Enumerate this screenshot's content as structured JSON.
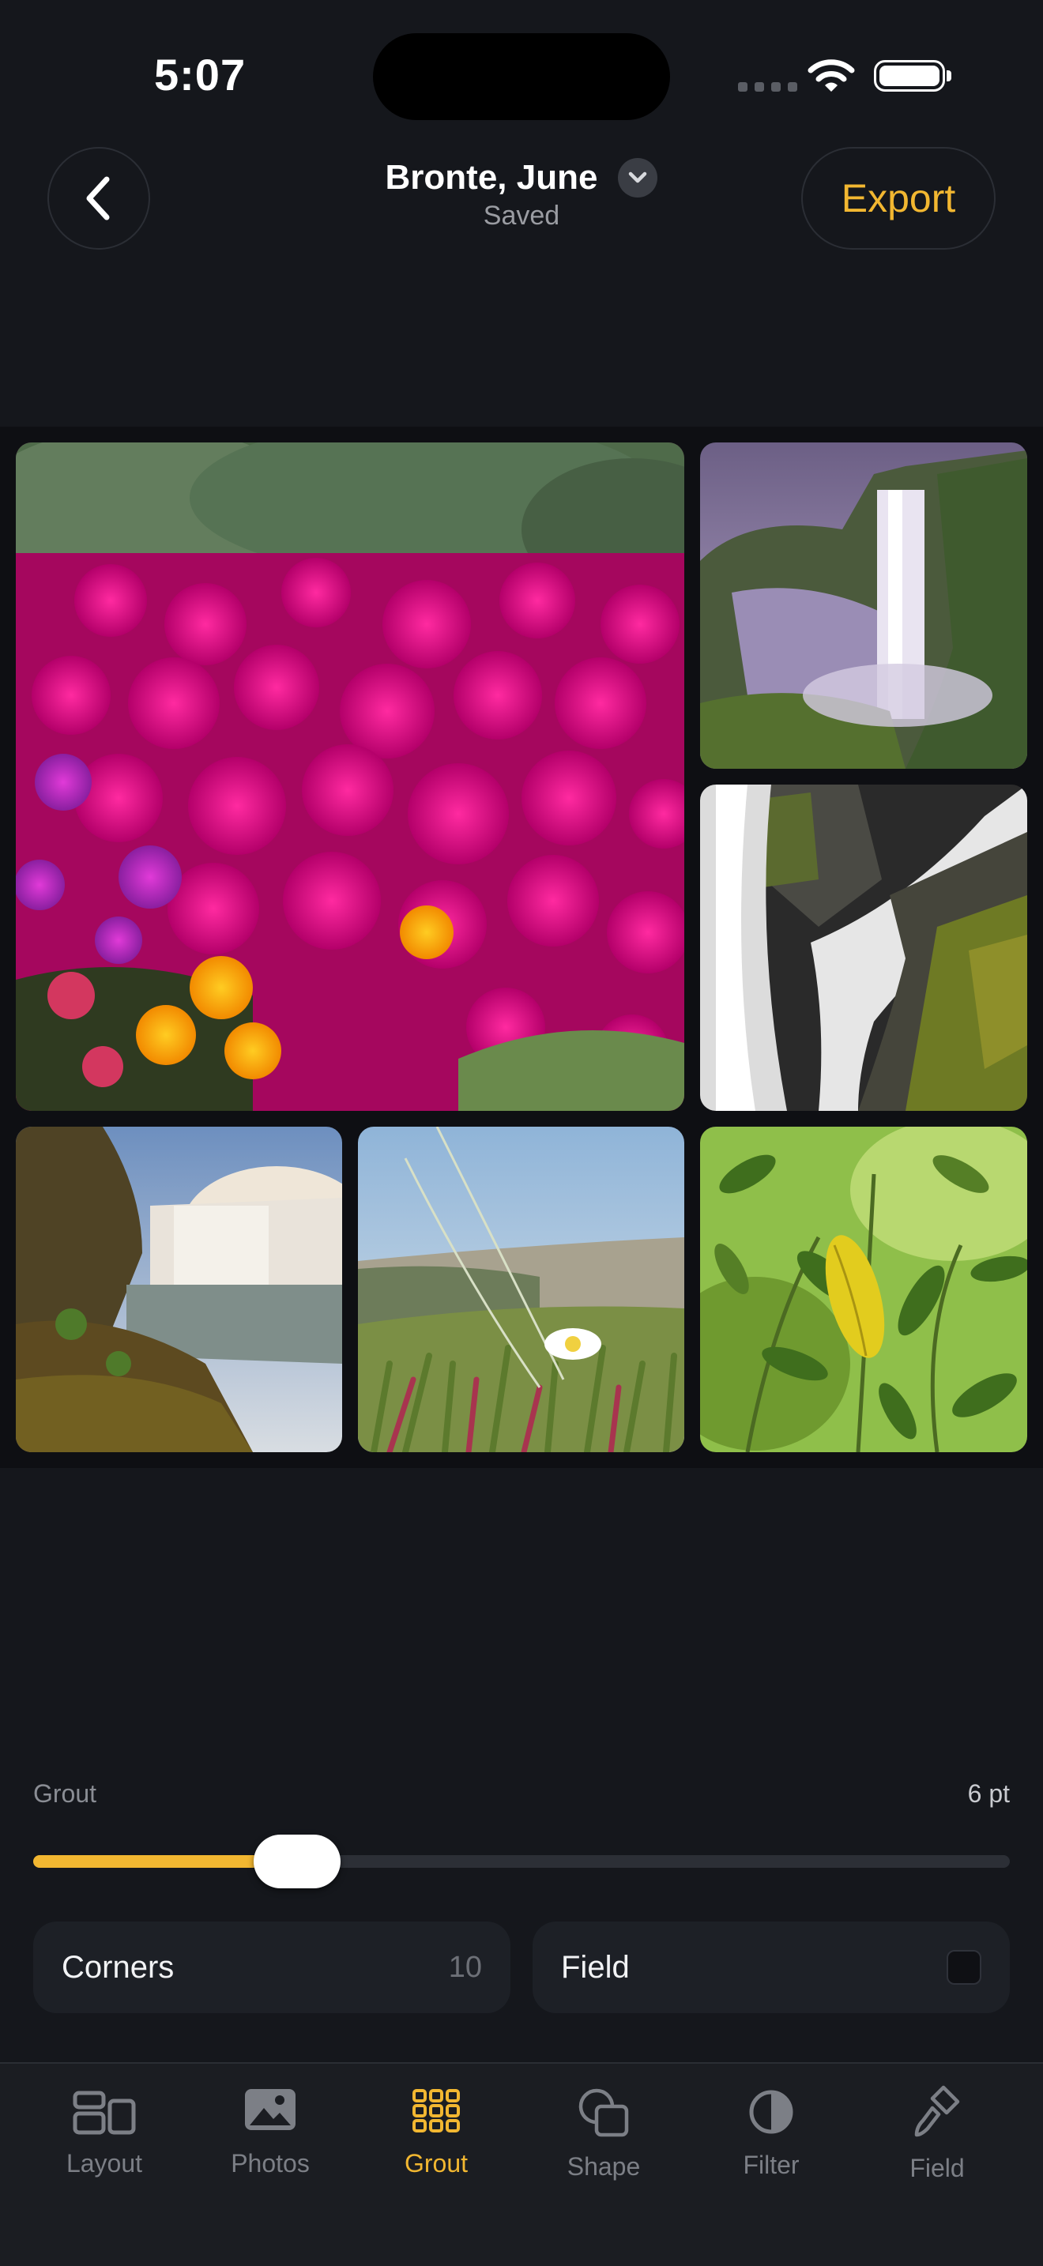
{
  "status": {
    "time": "5:07"
  },
  "header": {
    "title": "Bronte, June",
    "subtitle": "Saved",
    "export_label": "Export"
  },
  "collage": {
    "photos": [
      {
        "subject": "pink-ice-plant-flowers"
      },
      {
        "subject": "waterfall-misty-cliff"
      },
      {
        "subject": "waterfall-mossy-rock"
      },
      {
        "subject": "waterfall-coastal-rocks"
      },
      {
        "subject": "grass-white-flower"
      },
      {
        "subject": "green-leaves-yellow-leaf"
      }
    ]
  },
  "grout": {
    "label": "Grout",
    "value_text": "6 pt",
    "slider_fraction": 0.27
  },
  "cards": {
    "corners": {
      "label": "Corners",
      "value": "10"
    },
    "field": {
      "label": "Field",
      "checked": false
    }
  },
  "tabs": [
    {
      "label": "Layout",
      "icon": "layout-icon",
      "active": false
    },
    {
      "label": "Photos",
      "icon": "photo-icon",
      "active": false
    },
    {
      "label": "Grout",
      "icon": "grid-icon",
      "active": true
    },
    {
      "label": "Shape",
      "icon": "shape-icon",
      "active": false
    },
    {
      "label": "Filter",
      "icon": "filter-icon",
      "active": false
    },
    {
      "label": "Field",
      "icon": "brush-icon",
      "active": false
    }
  ],
  "colors": {
    "accent": "#f2b731",
    "background": "#15171c",
    "card": "#1d2026"
  }
}
